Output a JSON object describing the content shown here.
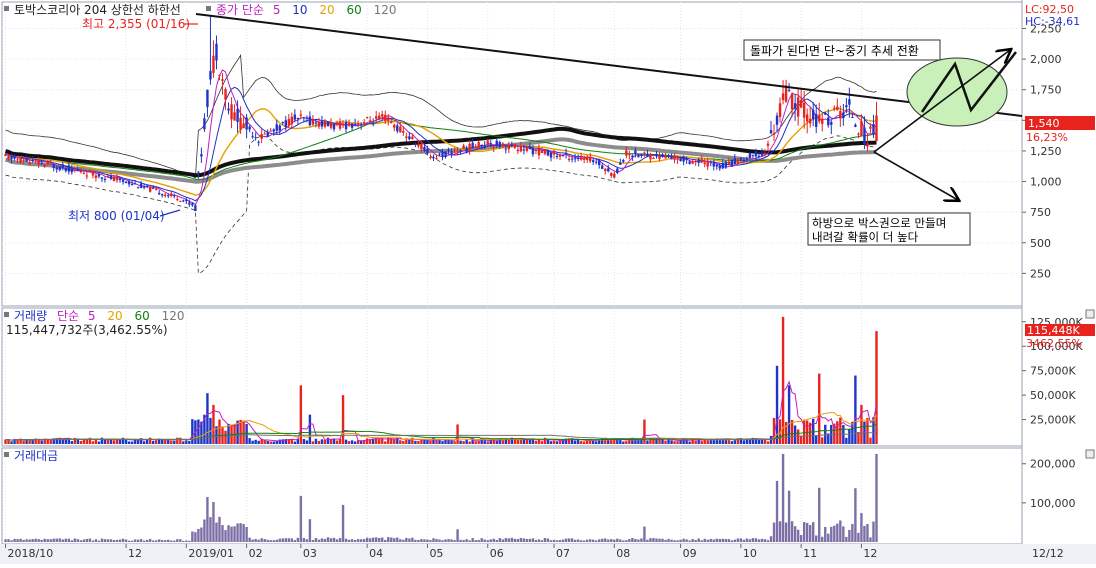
{
  "header": {
    "title": "토박스코리아 204 상한선 하한선",
    "price_ma_label": "종가 단순",
    "ma_periods": [
      "5",
      "10",
      "20",
      "60",
      "120"
    ],
    "lc": "LC:92,50",
    "hc": "HC:-34,61"
  },
  "annotations": {
    "high": "최고 2,355 (01/16)",
    "low": "최저 800 (01/04)",
    "note1": "돌파가 된다면 단~중기 추세 전환",
    "note2_line1": "하방으로 박스권으로 만들며",
    "note2_line2": "내려갈 확률이 더 높다"
  },
  "price_axis": {
    "ticks": [
      "2,250",
      "2,000",
      "1,750",
      "1,500",
      "1,250",
      "1,000",
      "750",
      "500",
      "250"
    ],
    "current_price": "1,540",
    "current_change": "16,23%"
  },
  "volume_panel": {
    "title": "거래량",
    "ma_label": "단순",
    "ma_periods": [
      "5",
      "20",
      "60",
      "120"
    ],
    "info": "115,447,732주(3,462.55%)",
    "ticks": [
      "125,000K",
      "100,000K",
      "75,000K",
      "50,000K",
      "25,000K"
    ],
    "current_value": "115,448K",
    "current_pct": "3462.55%"
  },
  "amount_panel": {
    "title": "거래대금",
    "ticks": [
      "200,000",
      "100,000"
    ]
  },
  "x_axis": {
    "labels": [
      "2018/10",
      "12",
      "2019/01",
      "02",
      "03",
      "04",
      "05",
      "06",
      "07",
      "08",
      "09",
      "10",
      "11",
      "12"
    ],
    "right_date": "12/12"
  },
  "chart_data": {
    "type": "candlestick",
    "price_range": [
      0,
      2450
    ],
    "volume_range_k": [
      0,
      135000
    ],
    "amount_range": [
      0,
      230000
    ],
    "price_path": [
      [
        "2018/10",
        1200
      ],
      [
        "2018/11",
        1050
      ],
      [
        "2018/12",
        900
      ],
      [
        "2019/01/04",
        800
      ],
      [
        "2019/01/16",
        2355
      ],
      [
        "2019/02",
        1400
      ],
      [
        "2019/03",
        1600
      ],
      [
        "2019/04",
        1500
      ],
      [
        "2019/05",
        1250
      ],
      [
        "2019/06",
        1300
      ],
      [
        "2019/07",
        1200
      ],
      [
        "2019/08",
        1050
      ],
      [
        "2019/09",
        1200
      ],
      [
        "2019/10",
        1100
      ],
      [
        "2019/11",
        1750
      ],
      [
        "2019/12",
        1350
      ],
      [
        "2019/12/12",
        1540
      ]
    ],
    "volume_spikes_k": [
      [
        "2019/01",
        50000
      ],
      [
        "2019/03",
        60000
      ],
      [
        "2019/04",
        50000
      ],
      [
        "2019/11",
        130000
      ],
      [
        "2019/12",
        112000
      ],
      [
        "2019/12/12",
        115448
      ]
    ]
  },
  "colors": {
    "up": "#e8231e",
    "down": "#1d34c8",
    "ma5": "#c020c0",
    "ma10": "#2030c0",
    "ma20": "#e8a000",
    "ma60": "#108010",
    "ma120": "#707070",
    "badge": "#e8231e",
    "ellipse": "#c8f0b8"
  }
}
